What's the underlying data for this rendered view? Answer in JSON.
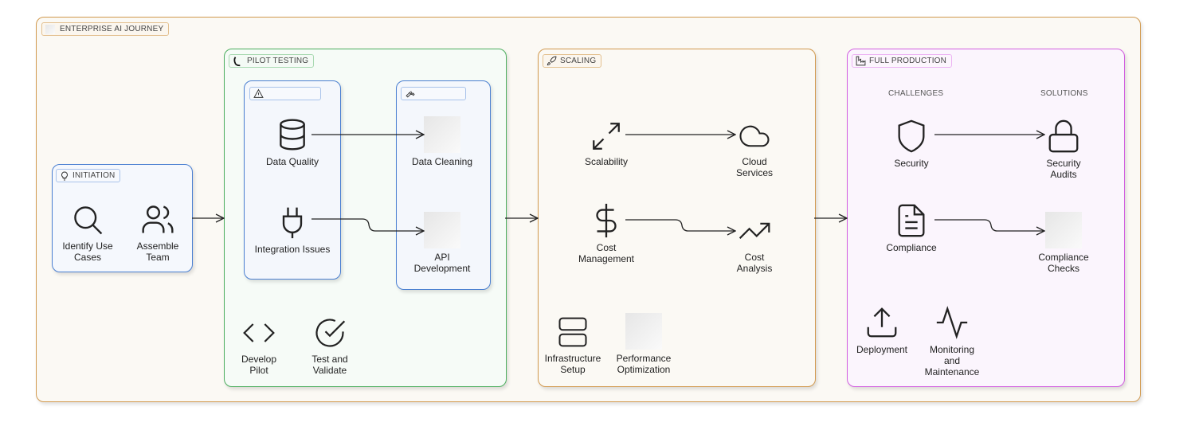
{
  "diagram": {
    "title": "ENTERPRISE AI JOURNEY",
    "colors": {
      "outer_border": "#d29a4f",
      "initiation_border": "#4a7fd1",
      "pilot_border": "#4cae5e",
      "scaling_border": "#d29a4f",
      "production_border": "#d25fe0"
    },
    "initiation": {
      "label": "INITIATION",
      "icon": "lightbulb-icon",
      "items": [
        {
          "label": "Identify Use Cases",
          "icon": "search-icon"
        },
        {
          "label": "Assemble Team",
          "icon": "users-icon"
        }
      ]
    },
    "pilot": {
      "label": "PILOT TESTING",
      "icon": "flask-icon",
      "issues": {
        "label": "",
        "icon": "warning-icon",
        "items": [
          {
            "label": "Data Quality",
            "icon": "database-icon"
          },
          {
            "label": "Integration Issues",
            "icon": "plug-icon"
          }
        ]
      },
      "fixes": {
        "label": "",
        "icon": "wrench-icon",
        "items": [
          {
            "label": "Data Cleaning",
            "icon": "image-placeholder"
          },
          {
            "label": "API Development",
            "icon": "image-placeholder"
          }
        ]
      },
      "steps": [
        {
          "label": "Develop Pilot",
          "icon": "code-icon"
        },
        {
          "label": "Test and Validate",
          "icon": "check-circle-icon"
        }
      ]
    },
    "scaling": {
      "label": "SCALING",
      "icon": "rocket-icon",
      "challenges": [
        {
          "label": "Scalability",
          "icon": "expand-icon"
        },
        {
          "label": "Cost Management",
          "icon": "dollar-icon"
        }
      ],
      "solutions": [
        {
          "label": "Cloud Services",
          "icon": "cloud-icon"
        },
        {
          "label": "Cost Analysis",
          "icon": "trending-up-icon"
        }
      ],
      "steps": [
        {
          "label": "Infrastructure Setup",
          "icon": "server-icon"
        },
        {
          "label": "Performance Optimization",
          "icon": "image-placeholder"
        }
      ]
    },
    "production": {
      "label": "FULL PRODUCTION",
      "icon": "factory-icon",
      "challenges_header": "CHALLENGES",
      "solutions_header": "SOLUTIONS",
      "challenges": [
        {
          "label": "Security",
          "icon": "shield-icon"
        },
        {
          "label": "Compliance",
          "icon": "document-icon"
        }
      ],
      "solutions": [
        {
          "label": "Security Audits",
          "icon": "lock-icon"
        },
        {
          "label": "Compliance Checks",
          "icon": "image-placeholder"
        }
      ],
      "steps": [
        {
          "label": "Deployment",
          "icon": "upload-icon"
        },
        {
          "label": "Monitoring and Maintenance",
          "icon": "activity-icon"
        }
      ]
    }
  }
}
